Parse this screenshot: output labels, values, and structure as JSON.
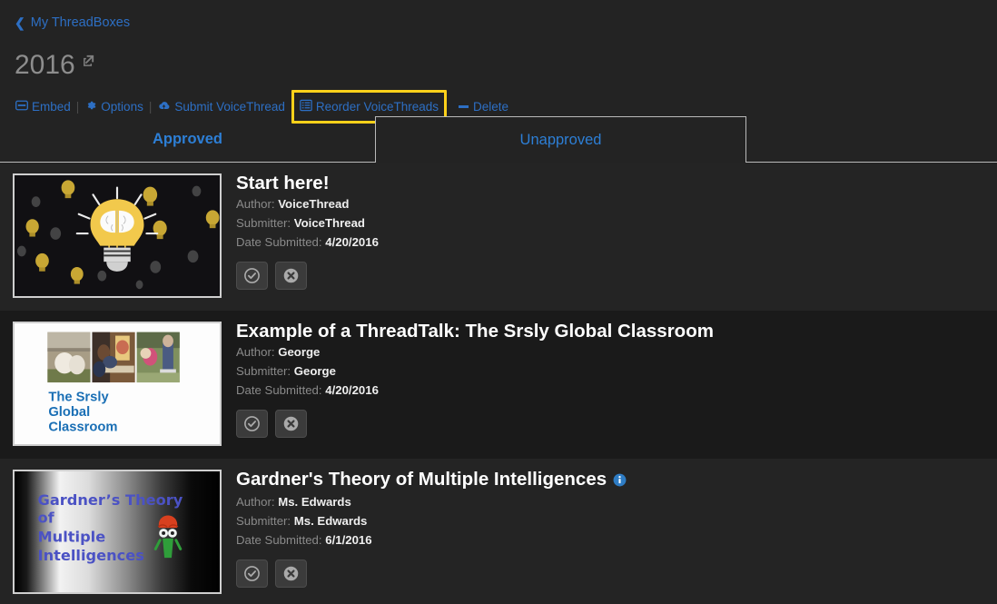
{
  "breadcrumb": {
    "icon": "chevron-left-icon",
    "label": "My ThreadBoxes"
  },
  "header": {
    "title": "2016",
    "external_link_icon": "external-link-icon"
  },
  "toolbar": {
    "embed": {
      "label": "Embed",
      "icon": "embed-icon"
    },
    "options": {
      "label": "Options",
      "icon": "gear-icon"
    },
    "submit": {
      "label": "Submit VoiceThread",
      "icon": "upload-cloud-icon"
    },
    "reorder": {
      "label": "Reorder VoiceThreads",
      "icon": "list-icon",
      "highlighted": true,
      "highlight_color": "#ffd11a"
    },
    "delete": {
      "label": "Delete",
      "icon": "minus-icon"
    },
    "separator": "|"
  },
  "tabs": [
    {
      "label": "Approved",
      "active": true
    },
    {
      "label": "Unapproved",
      "active": false
    }
  ],
  "labels": {
    "author": "Author:",
    "submitter": "Submitter:",
    "date_submitted": "Date Submitted:"
  },
  "actions": {
    "approve": {
      "icon": "check-circle-icon",
      "title": "Approve"
    },
    "reject": {
      "icon": "x-circle-icon",
      "title": "Reject"
    }
  },
  "items": [
    {
      "title": "Start here!",
      "author": "VoiceThread",
      "submitter": "VoiceThread",
      "date": "4/20/2016",
      "has_info": false,
      "thumbnail": "lightbulb-brain-thumbnail"
    },
    {
      "title": "Example of a ThreadTalk: The Srsly Global Classroom",
      "author": "George",
      "submitter": "George",
      "date": "4/20/2016",
      "has_info": false,
      "thumbnail": "srsly-global-classroom-thumbnail",
      "thumbnail_text": "The Srsly\nGlobal\nClassroom"
    },
    {
      "title": "Gardner's Theory of Multiple Intelligences",
      "author": "Ms. Edwards",
      "submitter": "Ms. Edwards",
      "date": "6/1/2016",
      "has_info": true,
      "info_icon": "info-circle-icon",
      "thumbnail": "gardner-theory-thumbnail",
      "thumbnail_text": "Gardner's Theory\nof\nMultiple\nIntelligences"
    }
  ],
  "colors": {
    "background": "#232323",
    "row_odd": "#242424",
    "row_even": "#1a1a1a",
    "link": "#2d6fc4",
    "tab_link": "#2d7fd6",
    "highlight": "#ffd11a",
    "title_gray": "#8d8d8d",
    "item_title": "#ffffff",
    "meta_label": "#8a8a8a"
  }
}
